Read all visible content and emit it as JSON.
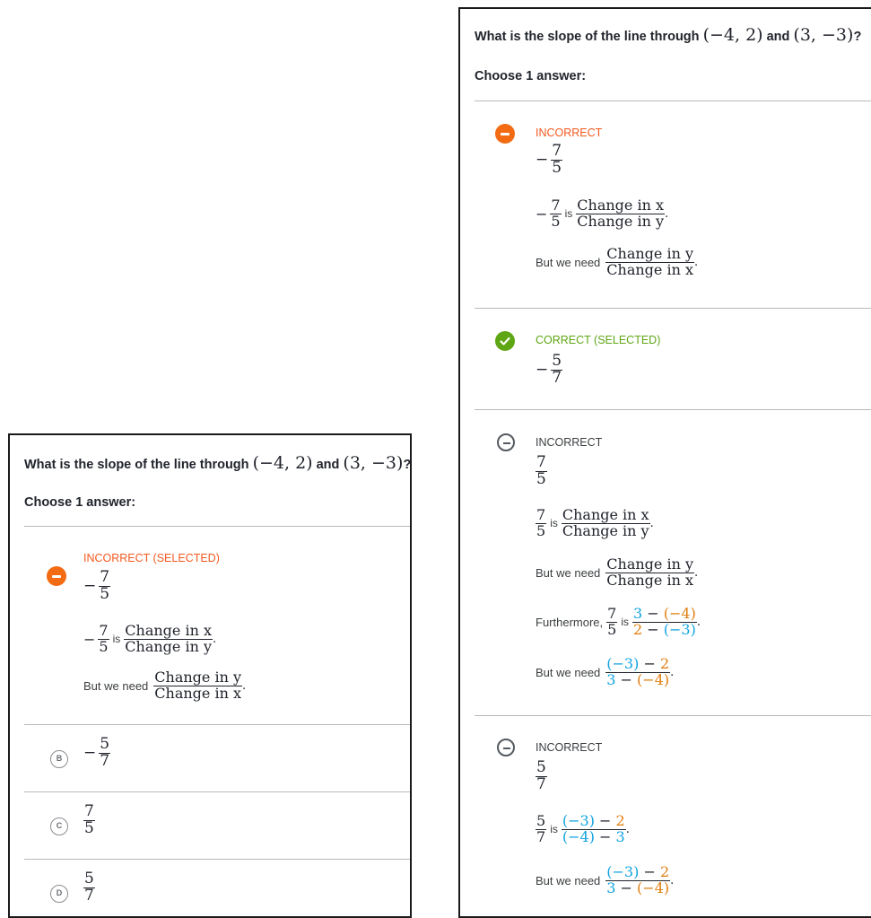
{
  "left": {
    "question_prefix": "What is the slope of the line through",
    "point1": "(−4, 2)",
    "and": "and",
    "point2": "(3, −3)",
    "qmark": "?",
    "choose_label": "Choose 1 answer:",
    "choice_a": {
      "status": "INCORRECT (SELECTED)",
      "answer": {
        "sign": "−",
        "num": "7",
        "den": "5"
      },
      "expl_is": "is",
      "expl_frac": {
        "num": "Change in x",
        "den": "Change in y"
      },
      "need_text": "But we need",
      "need_frac": {
        "num": "Change in y",
        "den": "Change in x"
      }
    },
    "choice_b": {
      "letter": "B",
      "sign": "−",
      "num": "5",
      "den": "7"
    },
    "choice_c": {
      "letter": "C",
      "num": "7",
      "den": "5"
    },
    "choice_d": {
      "letter": "D",
      "num": "5",
      "den": "7"
    }
  },
  "right": {
    "question_prefix": "What is the slope of the line through",
    "point1": "(−4, 2)",
    "and": "and",
    "point2": "(3, −3)",
    "qmark": "?",
    "choose_label": "Choose 1 answer:",
    "c1": {
      "status": "INCORRECT",
      "answer": {
        "sign": "−",
        "num": "7",
        "den": "5"
      },
      "expl_is": "is",
      "expl_frac": {
        "num": "Change in x",
        "den": "Change in y"
      },
      "need_text": "But we need",
      "need_frac": {
        "num": "Change in y",
        "den": "Change in x"
      }
    },
    "c2": {
      "status": "CORRECT (SELECTED)",
      "answer": {
        "sign": "−",
        "num": "5",
        "den": "7"
      }
    },
    "c3": {
      "status": "INCORRECT",
      "answer": {
        "num": "7",
        "den": "5"
      },
      "expl_is": "is",
      "expl_frac": {
        "num": "Change in x",
        "den": "Change in y"
      },
      "need_text": "But we need",
      "need_frac": {
        "num": "Change in y",
        "den": "Change in x"
      },
      "further_text": "Furthermore,",
      "further_frac_num": {
        "a": "3",
        "minus": " − ",
        "b": "(−4)"
      },
      "further_frac_den": {
        "a": "2",
        "minus": " − ",
        "b": "(−3)"
      },
      "need2_text": "But we need",
      "need2_frac_num": {
        "a": "(−3)",
        "minus": " − ",
        "b": "2"
      },
      "need2_frac_den": {
        "a": "3",
        "minus": " − ",
        "b": "(−4)"
      }
    },
    "c4": {
      "status": "INCORRECT",
      "answer": {
        "num": "5",
        "den": "7"
      },
      "expl_is": "is",
      "expl_frac_num": {
        "a": "(−3)",
        "minus": " − ",
        "b": "2"
      },
      "expl_frac_den": {
        "a": "(−4)",
        "minus": " − ",
        "b": "3"
      },
      "need_text": "But we need",
      "need_frac_num": {
        "a": "(−3)",
        "minus": " − ",
        "b": "2"
      },
      "need_frac_den": {
        "a": "3",
        "minus": " − ",
        "b": "(−4)"
      }
    }
  },
  "colors": {
    "incorrect": "#f3591e",
    "correct": "#5fa614",
    "blue": "#11a3e0",
    "orange": "#e07d10"
  },
  "icons": {
    "incorrect": "minus-circle-icon",
    "correct": "check-circle-icon",
    "unselected_incorrect": "minus-outline-icon"
  }
}
